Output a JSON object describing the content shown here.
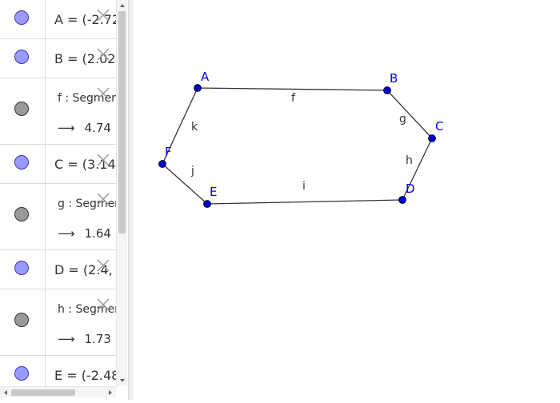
{
  "algebra_view": {
    "items": [
      {
        "kind": "point",
        "color": "blue",
        "definition": "A = (-2.72"
      },
      {
        "kind": "point",
        "color": "blue",
        "definition": "B = (2.02"
      },
      {
        "kind": "segment",
        "color": "gray",
        "definition": "f : Segmen",
        "value": "4.74"
      },
      {
        "kind": "point",
        "color": "blue",
        "definition": "C = (3.14"
      },
      {
        "kind": "segment",
        "color": "gray",
        "definition": "g : Segmen",
        "value": "1.64"
      },
      {
        "kind": "point",
        "color": "blue",
        "definition": "D = (2.4,"
      },
      {
        "kind": "segment",
        "color": "gray",
        "definition": "h : Segmen",
        "value": "1.73"
      },
      {
        "kind": "point",
        "color": "blue",
        "definition": "E = (-2.48"
      }
    ],
    "arrow_symbol": "⟶",
    "delete_icon": "close-icon"
  },
  "graphics_view": {
    "point_labels": {
      "A": "A",
      "B": "B",
      "C": "C",
      "D": "D",
      "E": "E",
      "F": "F"
    },
    "segment_labels": {
      "f": "f",
      "g": "g",
      "h": "h",
      "i": "i",
      "j": "j",
      "k": "k"
    }
  },
  "colors": {
    "point_fill": "#0000cc",
    "point_label": "#0000ff",
    "segment": "#333333",
    "marble_blue": "#9999ff",
    "marble_gray": "#999999"
  }
}
